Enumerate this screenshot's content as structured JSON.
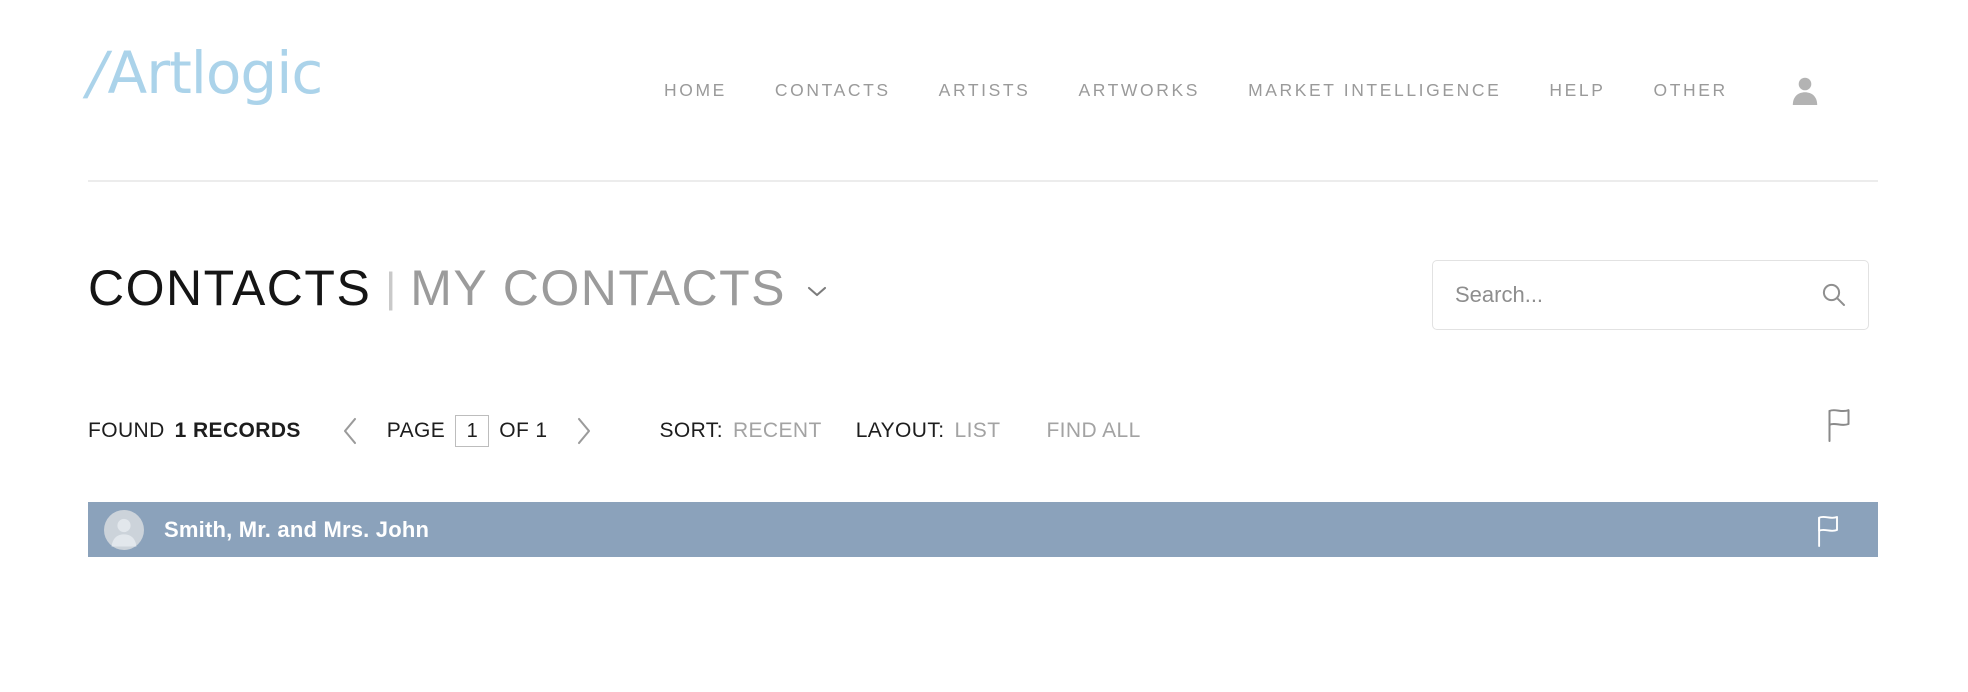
{
  "brand": {
    "logo_slash": "/",
    "logo_text": "Artlogic",
    "logo_color": "#abd3ea"
  },
  "topnav": {
    "items": [
      {
        "label": "HOME",
        "name": "home"
      },
      {
        "label": "CONTACTS",
        "name": "contacts"
      },
      {
        "label": "ARTISTS",
        "name": "artists"
      },
      {
        "label": "ARTWORKS",
        "name": "artworks"
      },
      {
        "label": "MARKET INTELLIGENCE",
        "name": "market-intelligence"
      },
      {
        "label": "HELP",
        "name": "help"
      },
      {
        "label": "OTHER",
        "name": "other"
      }
    ],
    "account_icon": "user-avatar-icon"
  },
  "page": {
    "title": "CONTACTS",
    "separator": "|",
    "subtitle": "MY CONTACTS",
    "subtitle_chevron": "chevron-down-icon"
  },
  "search": {
    "placeholder": "Search...",
    "value": "",
    "icon": "search-icon"
  },
  "toolbar": {
    "found_label": "FOUND",
    "found_count": "1 RECORDS",
    "prev_icon": "chevron-left-icon",
    "next_icon": "chevron-right-icon",
    "page_label": "PAGE",
    "page_value": "1",
    "page_of": "OF 1",
    "sort_label": "SORT:",
    "sort_value": "RECENT",
    "layout_label": "LAYOUT:",
    "layout_value": "LIST",
    "find_all_label": "FIND ALL",
    "flag_icon": "flag-icon"
  },
  "results": {
    "rows": [
      {
        "name": "Smith, Mr. and Mrs. John",
        "avatar_icon": "contact-avatar-icon",
        "flag_icon": "flag-icon",
        "selected": true
      }
    ],
    "row_color": "#8ba2bb"
  }
}
